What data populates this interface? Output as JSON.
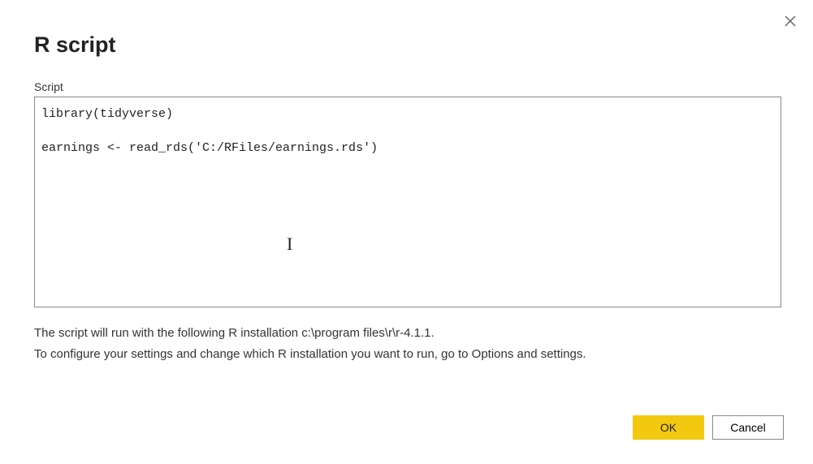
{
  "dialog": {
    "title": "R script",
    "script_label": "Script",
    "script_value": "library(tidyverse)\n\nearnings <- read_rds('C:/RFiles/earnings.rds')",
    "info_line1": "The script will run with the following R installation c:\\program files\\r\\r-4.1.1.",
    "info_line2": "To configure your settings and change which R installation you want to run, go to Options and settings."
  },
  "buttons": {
    "ok": "OK",
    "cancel": "Cancel"
  }
}
